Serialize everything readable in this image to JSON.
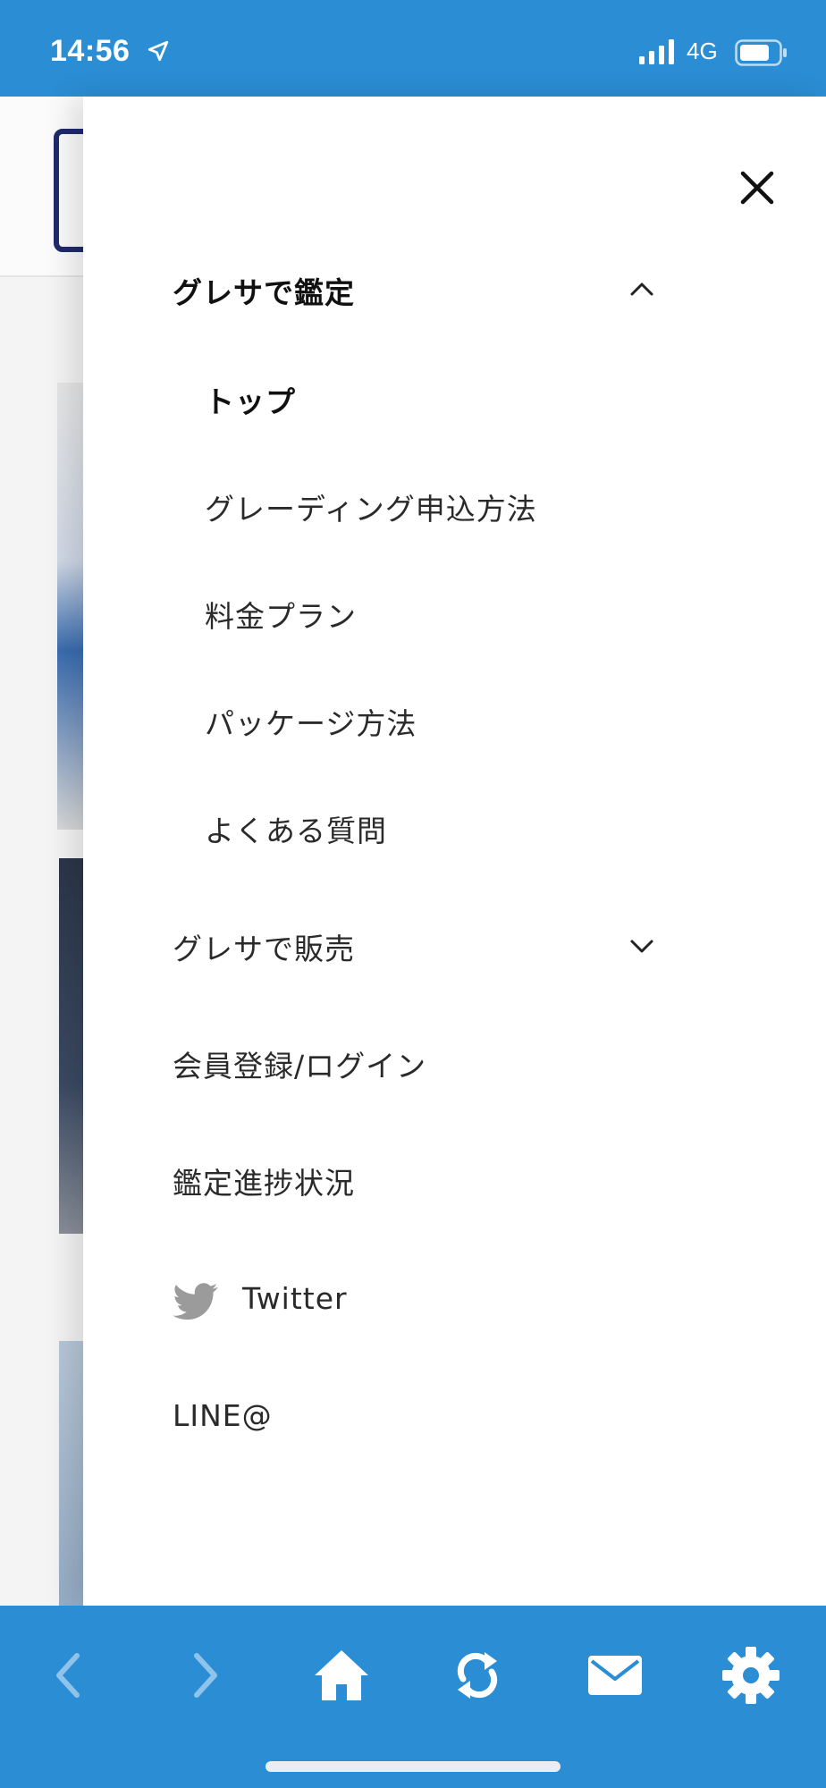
{
  "status_bar": {
    "time": "14:56",
    "network": "4G",
    "icons": [
      "location-arrow-icon",
      "signal-bars-icon",
      "battery-icon"
    ]
  },
  "colors": {
    "brand_blue": "#2b8dd3",
    "drawer_bg": "#ffffff",
    "text": "#222222",
    "icon_gray": "#9b9b9b"
  },
  "drawer": {
    "close_icon": "close-icon",
    "items": [
      {
        "label": "グレサで鑑定",
        "type": "section",
        "expanded": true,
        "icon": "chevron-up-icon"
      },
      {
        "label": "トップ",
        "type": "sub",
        "active": true
      },
      {
        "label": "グレーディング申込方法",
        "type": "sub"
      },
      {
        "label": "料金プラン",
        "type": "sub"
      },
      {
        "label": "パッケージ方法",
        "type": "sub"
      },
      {
        "label": "よくある質問",
        "type": "sub"
      },
      {
        "label": "グレサで販売",
        "type": "section",
        "expanded": false,
        "icon": "chevron-down-icon"
      },
      {
        "label": "会員登録/ログイン",
        "type": "section"
      },
      {
        "label": "鑑定進捗状況",
        "type": "section"
      },
      {
        "label": "Twitter",
        "type": "section",
        "icon": "twitter-bird-icon"
      },
      {
        "label": "LINE@",
        "type": "section"
      }
    ]
  },
  "toolbar": {
    "buttons": [
      "back-arrow-icon",
      "forward-arrow-icon",
      "home-icon",
      "refresh-icon",
      "mail-icon",
      "gear-icon"
    ]
  }
}
